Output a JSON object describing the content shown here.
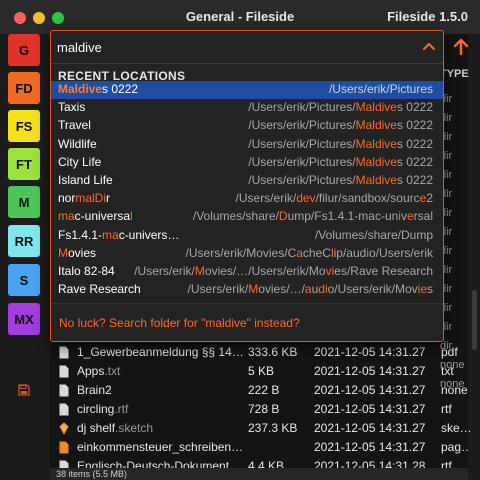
{
  "window": {
    "title": "General - Fileside",
    "app_version": "Fileside 1.5.0"
  },
  "favorites": [
    {
      "label": "G",
      "color": "#e0332a"
    },
    {
      "label": "FD",
      "color": "#f26a21"
    },
    {
      "label": "FS",
      "color": "#f5e11a"
    },
    {
      "label": "FT",
      "color": "#9be23a"
    },
    {
      "label": "M",
      "color": "#4cc456"
    },
    {
      "label": "RR",
      "color": "#7fe6ef"
    },
    {
      "label": "S",
      "color": "#4aa3f0"
    },
    {
      "label": "MX",
      "color": "#a23ce0"
    }
  ],
  "columns": {
    "type_header": "TYPE"
  },
  "background_types": [
    "dir",
    "dir",
    "dir",
    "dir",
    "dir",
    "dir",
    "dir",
    "dir",
    "dir",
    "dir",
    "dir",
    "dir",
    "dir",
    "dir",
    "none",
    "none"
  ],
  "search": {
    "value": "maldive",
    "section_title": "RECENT LOCATIONS",
    "no_luck_text": "No luck? Search folder for \"maldive\" instead?"
  },
  "locations": [
    {
      "name": [
        {
          "t": "Maldive",
          "h": true
        },
        {
          "t": "s 0222",
          "h": false
        }
      ],
      "path": [
        {
          "t": "/Users/erik/Pictures",
          "h": false
        }
      ],
      "selected": true
    },
    {
      "name": [
        {
          "t": "Taxis",
          "h": false
        }
      ],
      "path": [
        {
          "t": "/Users/erik/Pictures/",
          "h": false
        },
        {
          "t": "Maldive",
          "h": true
        },
        {
          "t": "s 0222",
          "h": false
        }
      ],
      "selected": false
    },
    {
      "name": [
        {
          "t": "Travel",
          "h": false
        }
      ],
      "path": [
        {
          "t": "/Users/erik/Pictures/",
          "h": false
        },
        {
          "t": "Maldive",
          "h": true
        },
        {
          "t": "s 0222",
          "h": false
        }
      ],
      "selected": false
    },
    {
      "name": [
        {
          "t": "Wildlife",
          "h": false
        }
      ],
      "path": [
        {
          "t": "/Users/erik/Pictures/",
          "h": false
        },
        {
          "t": "Maldive",
          "h": true
        },
        {
          "t": "s 0222",
          "h": false
        }
      ],
      "selected": false
    },
    {
      "name": [
        {
          "t": "City Life",
          "h": false
        }
      ],
      "path": [
        {
          "t": "/Users/erik/Pictures/",
          "h": false
        },
        {
          "t": "Maldive",
          "h": true
        },
        {
          "t": "s 0222",
          "h": false
        }
      ],
      "selected": false
    },
    {
      "name": [
        {
          "t": "Island Life",
          "h": false
        }
      ],
      "path": [
        {
          "t": "/Users/erik/Pictures/",
          "h": false
        },
        {
          "t": "Maldive",
          "h": true
        },
        {
          "t": "s 0222",
          "h": false
        }
      ],
      "selected": false
    },
    {
      "name": [
        {
          "t": "nor",
          "h": false
        },
        {
          "t": "malDi",
          "h": true
        },
        {
          "t": "r",
          "h": false
        }
      ],
      "path": [
        {
          "t": "/Users/erik/",
          "h": false
        },
        {
          "t": "dev",
          "h": true
        },
        {
          "t": "/filur/sandbox/sourc",
          "h": false
        },
        {
          "t": "e",
          "h": true
        },
        {
          "t": "2",
          "h": false
        }
      ],
      "selected": false
    },
    {
      "name": [
        {
          "t": "ma",
          "h": true
        },
        {
          "t": "c-universa",
          "h": false
        },
        {
          "t": "l",
          "h": true
        }
      ],
      "path": [
        {
          "t": "/Volumes/share/",
          "h": false
        },
        {
          "t": "D",
          "h": true
        },
        {
          "t": "ump/Fs1.4.1-mac-un",
          "h": false
        },
        {
          "t": "i",
          "h": true
        },
        {
          "t": "v",
          "h": false
        },
        {
          "t": "e",
          "h": true
        },
        {
          "t": "rsal",
          "h": false
        }
      ],
      "selected": false
    },
    {
      "name": [
        {
          "t": "Fs1.4.1-",
          "h": false
        },
        {
          "t": "ma",
          "h": true
        },
        {
          "t": "c-univers…",
          "h": false
        }
      ],
      "path": [
        {
          "t": "/Volumes/share/Dump",
          "h": false
        }
      ],
      "selected": false
    },
    {
      "name": [
        {
          "t": "M",
          "h": true
        },
        {
          "t": "ovies",
          "h": false
        }
      ],
      "path": [
        {
          "t": "/Users/erik/Movies/",
          "h": false
        },
        {
          "t": "C",
          "h": false
        },
        {
          "t": "a",
          "h": true
        },
        {
          "t": "cheC",
          "h": false
        },
        {
          "t": "l",
          "h": true
        },
        {
          "t": "ip/aud",
          "h": false
        },
        {
          "t": "i",
          "h": true
        },
        {
          "t": "o/Users/erik",
          "h": false
        }
      ],
      "selected": false
    },
    {
      "name": [
        {
          "t": "Italo 82-84",
          "h": false
        }
      ],
      "path": [
        {
          "t": "/Users/erik/",
          "h": false
        },
        {
          "t": "M",
          "h": true
        },
        {
          "t": "ovies/…/Users/erik/Mo",
          "h": false
        },
        {
          "t": "vi",
          "h": true
        },
        {
          "t": "es/Rave Research",
          "h": false
        }
      ],
      "selected": false
    },
    {
      "name": [
        {
          "t": "Rave Research",
          "h": false
        }
      ],
      "path": [
        {
          "t": "/Users/erik/",
          "h": false
        },
        {
          "t": "M",
          "h": true
        },
        {
          "t": "ovies/…/",
          "h": false
        },
        {
          "t": "a",
          "h": true
        },
        {
          "t": "u",
          "h": false
        },
        {
          "t": "di",
          "h": true
        },
        {
          "t": "o/Users/erik/Mov",
          "h": false
        },
        {
          "t": "ie",
          "h": true
        },
        {
          "t": "s",
          "h": false
        }
      ],
      "selected": false
    }
  ],
  "files": [
    {
      "name": "1_Gewerbeanmeldung §§ 14…",
      "ext": "",
      "size": "333.6 KB",
      "date": "2021-12-05 14:31.27",
      "type": "pdf"
    },
    {
      "name": "Apps",
      "ext": ".txt",
      "size": "5 KB",
      "date": "2021-12-05 14:31.27",
      "type": "txt"
    },
    {
      "name": "Brain2",
      "ext": "",
      "size": "222 B",
      "date": "2021-12-05 14:31.27",
      "type": "none"
    },
    {
      "name": "circling",
      "ext": ".rtf",
      "size": "728 B",
      "date": "2021-12-05 14:31.27",
      "type": "rtf"
    },
    {
      "name": "dj shelf",
      "ext": ".sketch",
      "size": "237.3 KB",
      "date": "2021-12-05 14:31.27",
      "type": "ske…"
    },
    {
      "name": "einkommensteuer_schreiben…",
      "ext": "",
      "size": "",
      "date": "2021-12-05 14:31.27",
      "type": "pag…"
    },
    {
      "name": "Englisch-Deutsch-Dokument…",
      "ext": "",
      "size": "4.4 KB",
      "date": "2021-12-05 14:31.28",
      "type": "rtf"
    }
  ],
  "status": {
    "text": "38 items (5.5 MB)"
  }
}
